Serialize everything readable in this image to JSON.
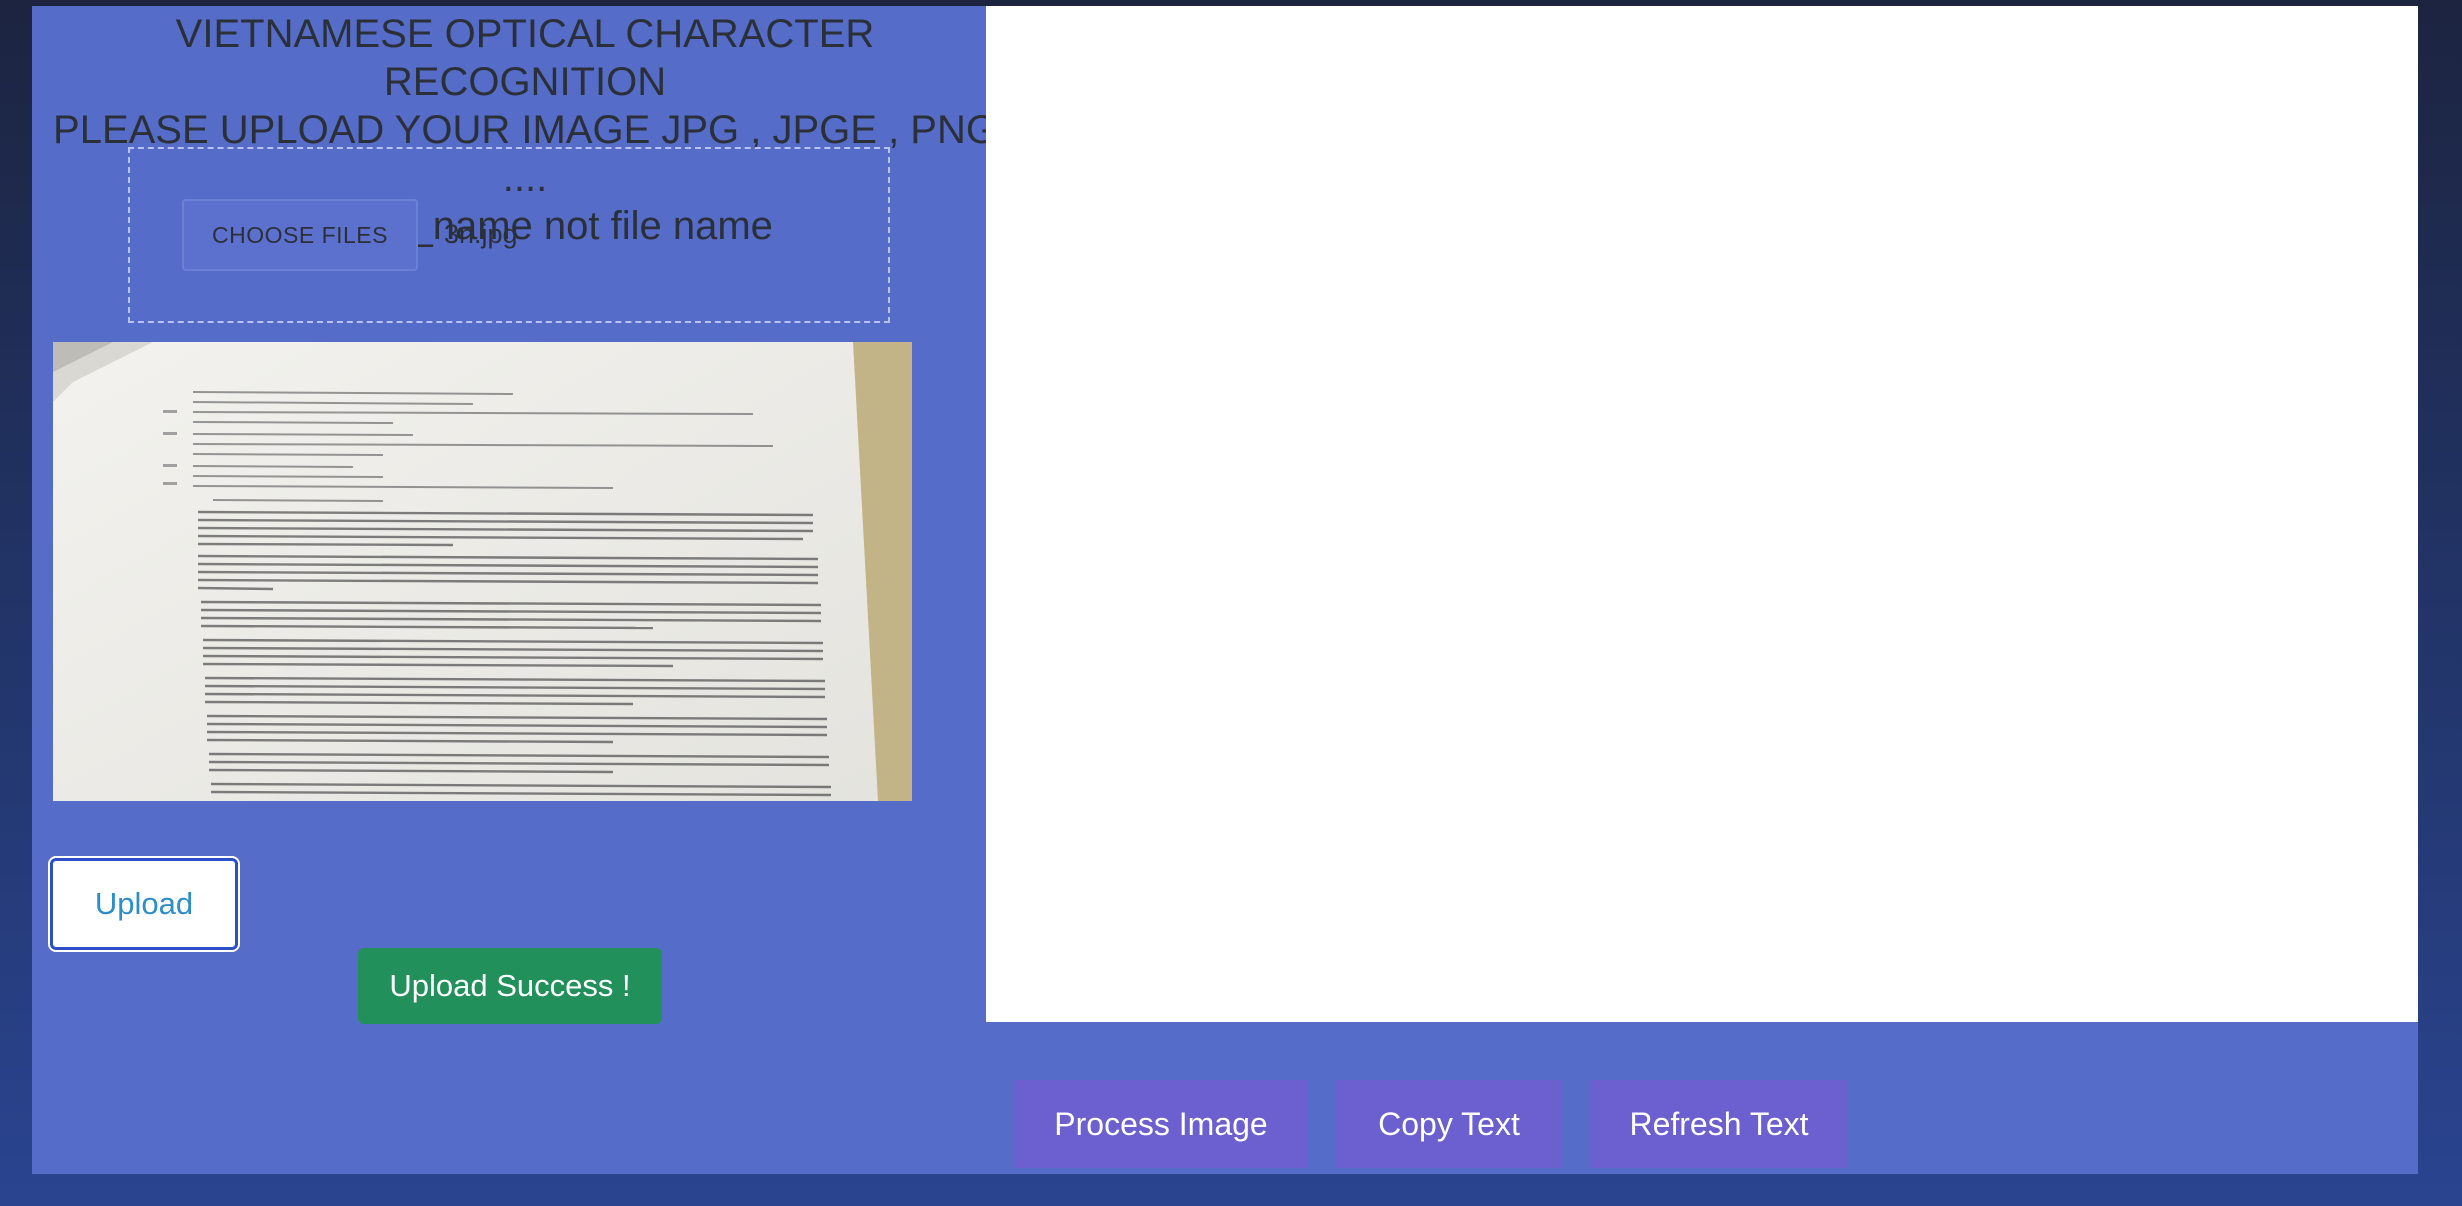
{
  "header": {
    "title_line1": "VIETNAMESE OPTICAL CHARACTER RECOGNITION",
    "title_line2": "PLEASE UPLOAD YOUR IMAGE JPG , JPGE , PNG ....",
    "title_line3": "with file_name not file name"
  },
  "file_input": {
    "button_label": "CHOOSE FILES",
    "selected_file": "3n.jpg"
  },
  "upload": {
    "button_label": "Upload",
    "status_message": "Upload Success !"
  },
  "output": {
    "text_value": ""
  },
  "actions": {
    "process_label": "Process Image",
    "copy_label": "Copy Text",
    "refresh_label": "Refresh Text"
  },
  "colors": {
    "panel_bg": "#566cc9",
    "success_green": "#21905a",
    "action_purple": "#6c5fd0",
    "upload_text_blue": "#2d8ec9"
  }
}
